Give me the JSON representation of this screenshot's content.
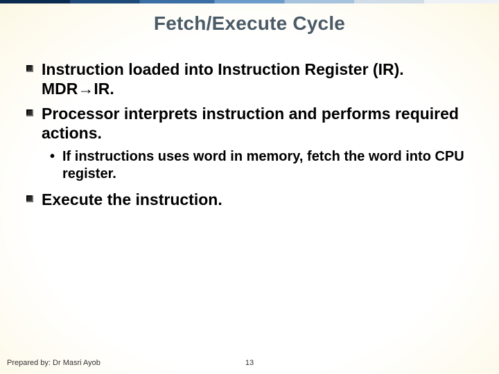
{
  "title": "Fetch/Execute Cycle",
  "bullets": {
    "b1a_part1": "Instruction loaded into Instruction Register (IR). MDR",
    "b1a_arrow": "→",
    "b1a_part2": "IR.",
    "b1b": "Processor interprets instruction and performs required actions.",
    "b2a": "If instructions uses word in memory, fetch the word into CPU register.",
    "b1c": "Execute the instruction."
  },
  "footer": {
    "prepared": "Prepared by: Dr Masri Ayob",
    "page": "13"
  }
}
